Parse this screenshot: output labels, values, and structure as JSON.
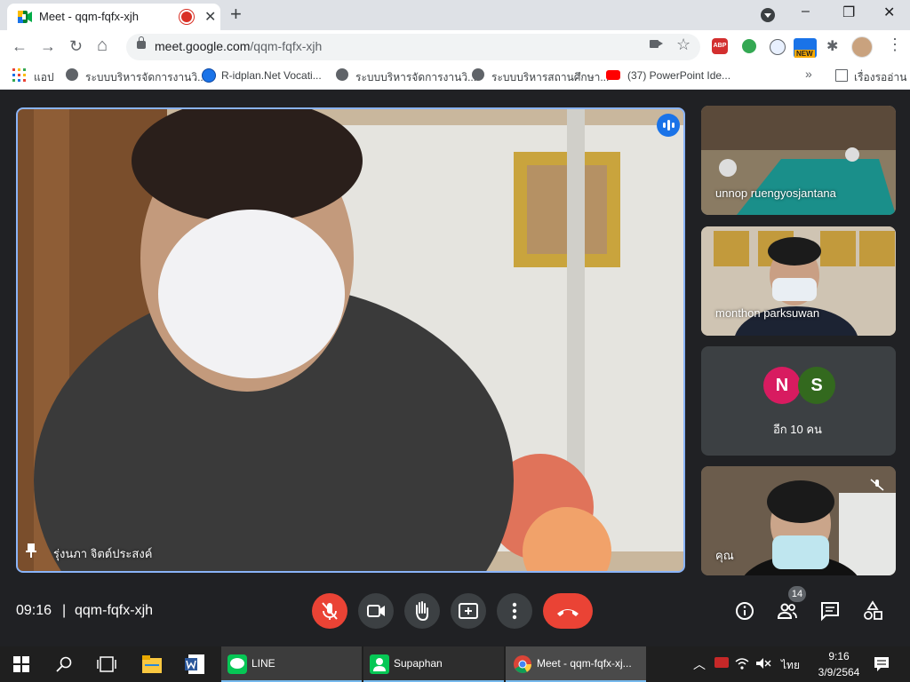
{
  "browser": {
    "tab_title": "Meet - qqm-fqfx-xjh",
    "url_host": "meet.google.com",
    "url_path": "/qqm-fqfx-xjh",
    "abp_label": "ABP",
    "new_badge": "NEW",
    "win_minimize": "–",
    "win_restore": "❐",
    "win_close": "✕",
    "tab_close": "✕",
    "new_tab": "+",
    "back": "←",
    "forward": "→",
    "reload": "↻",
    "home": "⌂",
    "star": "☆",
    "puzzle": "✱",
    "menu": "⋮"
  },
  "bookmarks": {
    "apps_label": "แอป",
    "items": [
      "ระบบบริหารจัดการงานวิ...",
      "R-idplan.Net Vocati...",
      "ระบบบริหารจัดการงานวิ...",
      "ระบบบริหารสถานศึกษา...",
      "(37) PowerPoint Ide..."
    ],
    "more": "»",
    "reading_list": "เรื่องรออ่าน"
  },
  "meet": {
    "main_speaker": "รุ่งนภา จิตต์ประสงค์",
    "tiles": [
      {
        "name": "unnop ruengyosjantana"
      },
      {
        "name": "monthon parksuwan"
      },
      {
        "name": "คุณ"
      }
    ],
    "others": {
      "avatars": [
        {
          "letter": "N",
          "color": "#d81b60"
        },
        {
          "letter": "S",
          "color": "#33691e"
        }
      ],
      "more_label": "อีก 10 คน"
    },
    "time": "09:16",
    "separator": "|",
    "meeting_code": "qqm-fqfx-xjh",
    "participants_count": "14",
    "accent": "#1a73e8",
    "danger": "#ea4335"
  },
  "taskbar": {
    "apps": [
      {
        "label": "LINE"
      },
      {
        "label": "Supaphan"
      },
      {
        "label": "Meet - qqm-fqfx-xj..."
      }
    ],
    "lang": "ไทย",
    "clock_time": "9:16",
    "clock_date": "3/9/2564"
  }
}
